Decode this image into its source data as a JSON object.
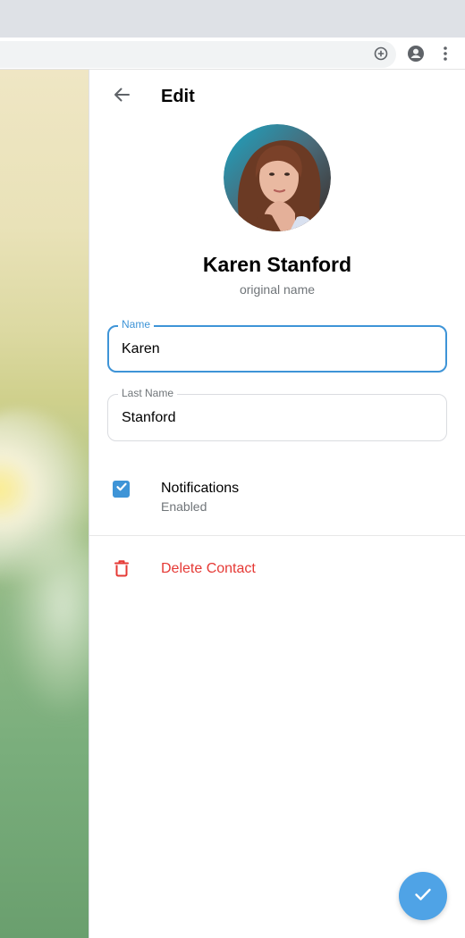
{
  "header": {
    "title": "Edit"
  },
  "profile": {
    "full_name": "Karen Stanford",
    "subtitle": "original name"
  },
  "fields": {
    "name": {
      "label": "Name",
      "value": "Karen"
    },
    "last_name": {
      "label": "Last Name",
      "value": "Stanford"
    }
  },
  "notifications": {
    "label": "Notifications",
    "status": "Enabled",
    "checked": true
  },
  "actions": {
    "delete_label": "Delete Contact"
  },
  "colors": {
    "accent": "#3e94d7",
    "fab": "#4fa3e6",
    "danger": "#e53935",
    "secondary_text": "#707579"
  },
  "icons": {
    "back": "arrow-left-icon",
    "checkbox": "check-icon",
    "delete": "trash-icon",
    "fab": "check-icon",
    "browser_add": "plus-circle-icon",
    "browser_account": "account-circle-icon",
    "browser_menu": "more-vertical-icon"
  }
}
